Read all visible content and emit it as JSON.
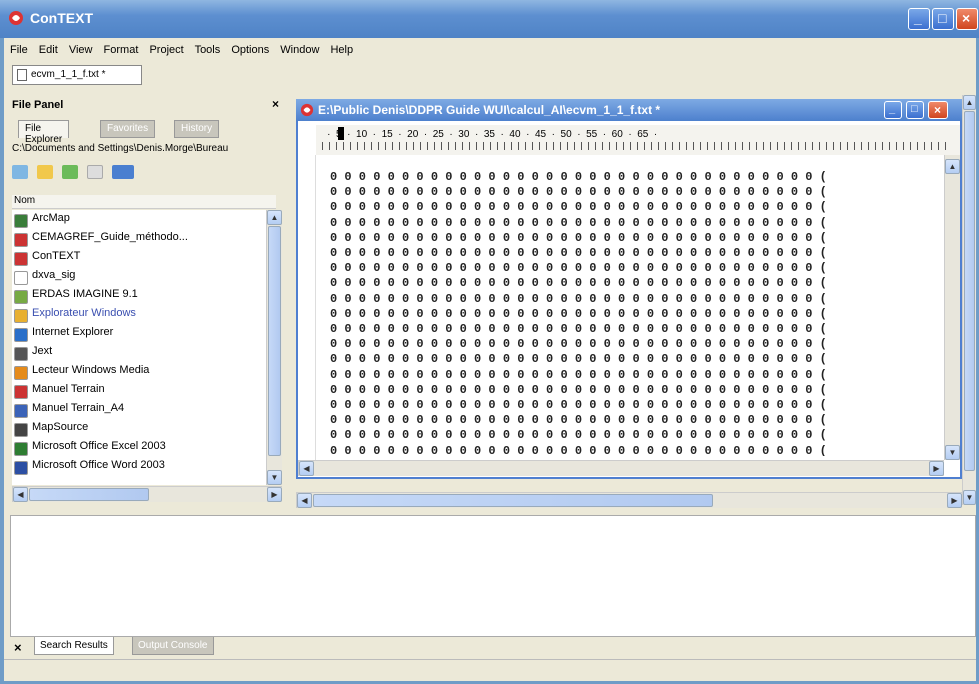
{
  "window": {
    "title": "ConTEXT",
    "colors": {
      "titlebar": "#4f83c6",
      "close": "#d0461f"
    }
  },
  "menu": [
    "File",
    "Edit",
    "View",
    "Format",
    "Project",
    "Tools",
    "Options",
    "Window",
    "Help"
  ],
  "doc_tab": "ecvm_1_1_f.txt *",
  "file_panel": {
    "title": "File Panel",
    "close": "×",
    "tabs": [
      "File Explorer",
      "Favorites",
      "History"
    ],
    "path": "C:\\Documents and Settings\\Denis.Morge\\Bureau",
    "column_header": "Nom",
    "items": [
      {
        "label": "ArcMap",
        "icon": "globe-icon",
        "color": "#3a7d3a"
      },
      {
        "label": "CEMAGREF_Guide_méthodo...",
        "icon": "pdf-icon",
        "color": "#c33"
      },
      {
        "label": "ConTEXT",
        "icon": "context-icon",
        "color": "#c33"
      },
      {
        "label": "dxva_sig",
        "icon": "file-icon",
        "color": "#fff"
      },
      {
        "label": "ERDAS IMAGINE 9.1",
        "icon": "erdas-icon",
        "color": "#7a4"
      },
      {
        "label": "Explorateur Windows",
        "icon": "explorer-icon",
        "color": "#e8b030"
      },
      {
        "label": "Internet Explorer",
        "icon": "ie-icon",
        "color": "#2a6fc9"
      },
      {
        "label": "Jext",
        "icon": "jext-icon",
        "color": "#555"
      },
      {
        "label": "Lecteur Windows Media",
        "icon": "media-icon",
        "color": "#e58b1a"
      },
      {
        "label": "Manuel Terrain",
        "icon": "pdf-icon",
        "color": "#c33"
      },
      {
        "label": "Manuel Terrain_A4",
        "icon": "word-icon",
        "color": "#3b63b8"
      },
      {
        "label": "MapSource",
        "icon": "mapsource-icon",
        "color": "#444"
      },
      {
        "label": "Microsoft Office Excel 2003",
        "icon": "excel-icon",
        "color": "#2e7d32"
      },
      {
        "label": "Microsoft Office Word 2003",
        "icon": "word-icon",
        "color": "#2c4fa3"
      }
    ]
  },
  "editor": {
    "title": "E:\\Public Denis\\DDPR Guide WUI\\calcul_AI\\ecvm_1_1_f.txt *",
    "ruler": "    ·  5  ·  10  ·  15  ·  20  ·  25  ·  30  ·  35  ·  40  ·  45  ·  50  ·  55  ·  60  ·  65  ·",
    "line_text": "0 0 0 0 0 0 0 0 0 0 0 0 0 0 0 0 0 0 0 0 0 0 0 0 0 0 0 0 0 0 0 0 0 0 (",
    "line_count": 19
  },
  "bottom_panel": {
    "tabs": [
      "Search Results",
      "Output Console"
    ],
    "close": "×"
  }
}
